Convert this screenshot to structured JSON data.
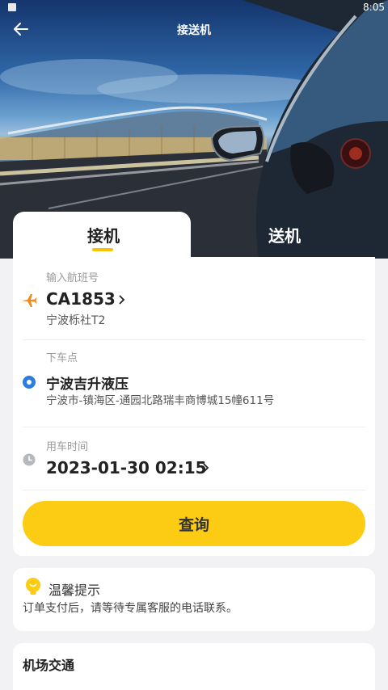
{
  "status_bar": {
    "time": "8:05"
  },
  "header": {
    "title": "接送机"
  },
  "tabs": [
    {
      "label": "接机",
      "active": true
    },
    {
      "label": "送机",
      "active": false
    }
  ],
  "flight": {
    "label": "输入航班号",
    "number": "CA1853",
    "airport": "宁波栎社T2",
    "icon": "plane-icon"
  },
  "dropoff": {
    "label": "下车点",
    "name": "宁波吉升液压",
    "address": "宁波市-镇海区-通园北路瑞丰商博城15幢611号",
    "icon": "location-dot-icon"
  },
  "time": {
    "label": "用车时间",
    "value": "2023-01-30 02:15",
    "icon": "clock-icon"
  },
  "query_button": {
    "label": "查询"
  },
  "tip": {
    "title": "温馨提示",
    "text": "订单支付后，请等待专属客服的电话联系。",
    "icon": "lightbulb-icon"
  },
  "traffic": {
    "title": "机场交通"
  },
  "colors": {
    "accent": "#fccb14",
    "plane": "#f08a1c",
    "location": "#2b7de0"
  }
}
